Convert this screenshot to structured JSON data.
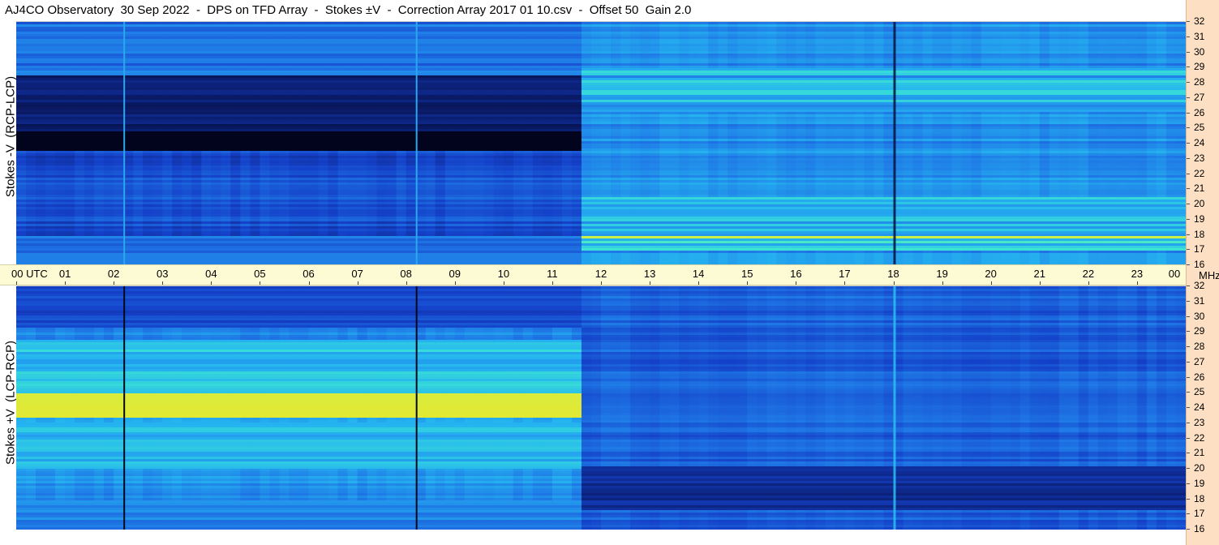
{
  "title": "AJ4CO Observatory  30 Sep 2022  -  DPS on TFD Array  -  Stokes ±V  -  Correction Array 2017 01 10.csv  -  Offset 50  Gain 2.0",
  "colors": {
    "time_axis_bg": "#fdfbd3",
    "freq_axis_bg": "#fde0c4",
    "colormap": [
      "#000010",
      "#0a1a66",
      "#1440c8",
      "#1f78e6",
      "#25b4f0",
      "#3ce6d2",
      "#c8f04a",
      "#f0e628",
      "#f08c1e"
    ]
  },
  "chart_data": [
    {
      "type": "heatmap",
      "name": "panel-top",
      "ylabel": "Stokes -V  (RCP-LCP)",
      "xlabel": "UTC",
      "x_ticks": [
        "00",
        "01",
        "02",
        "03",
        "04",
        "05",
        "06",
        "07",
        "08",
        "09",
        "10",
        "11",
        "12",
        "13",
        "14",
        "15",
        "16",
        "17",
        "18",
        "19",
        "20",
        "21",
        "22",
        "23",
        "00"
      ],
      "x_range_hours": [
        0,
        24
      ],
      "y_ticks": [
        "32",
        "31",
        "30",
        "29",
        "28",
        "27",
        "26",
        "25",
        "24",
        "23",
        "22",
        "21",
        "20",
        "19",
        "18",
        "17",
        "16"
      ],
      "y_range_mhz": [
        16,
        32
      ],
      "y_unit": "MHz",
      "features": {
        "night_end_hour": 11.65,
        "night_deep_band_mhz": [
          23.5,
          24.8
        ],
        "night_dark_band_mhz": [
          24,
          28.5
        ],
        "day_bright_band_mhz": [
          17,
          18.5
        ],
        "vertical_lines_hours": [
          2.2,
          8.2
        ],
        "vertical_dark_hour": 18.0
      }
    },
    {
      "type": "heatmap",
      "name": "panel-bottom",
      "ylabel": "Stokes +V  (LCP-RCP)",
      "xlabel": "UTC",
      "x_ticks": [
        "00",
        "01",
        "02",
        "03",
        "04",
        "05",
        "06",
        "07",
        "08",
        "09",
        "10",
        "11",
        "12",
        "13",
        "14",
        "15",
        "16",
        "17",
        "18",
        "19",
        "20",
        "21",
        "22",
        "23",
        "00"
      ],
      "x_range_hours": [
        0,
        24
      ],
      "y_ticks": [
        "32",
        "31",
        "30",
        "29",
        "28",
        "27",
        "26",
        "25",
        "24",
        "23",
        "22",
        "21",
        "20",
        "19",
        "18",
        "17",
        "16"
      ],
      "y_range_mhz": [
        16,
        32
      ],
      "y_unit": "MHz",
      "features": {
        "night_end_hour": 11.65,
        "night_bright_band_mhz": [
          23.3,
          24.9
        ],
        "day_dark_band_mhz": [
          17.3,
          20.2
        ],
        "vertical_lines_hours": [
          2.2,
          8.2
        ],
        "vertical_bright_hour": 18.0
      }
    }
  ],
  "time_axis": {
    "labels": [
      "00  UTC",
      "01",
      "02",
      "03",
      "04",
      "05",
      "06",
      "07",
      "08",
      "09",
      "10",
      "11",
      "12",
      "13",
      "14",
      "15",
      "16",
      "17",
      "18",
      "19",
      "20",
      "21",
      "22",
      "23",
      "00"
    ]
  },
  "freq_unit": "MHz"
}
